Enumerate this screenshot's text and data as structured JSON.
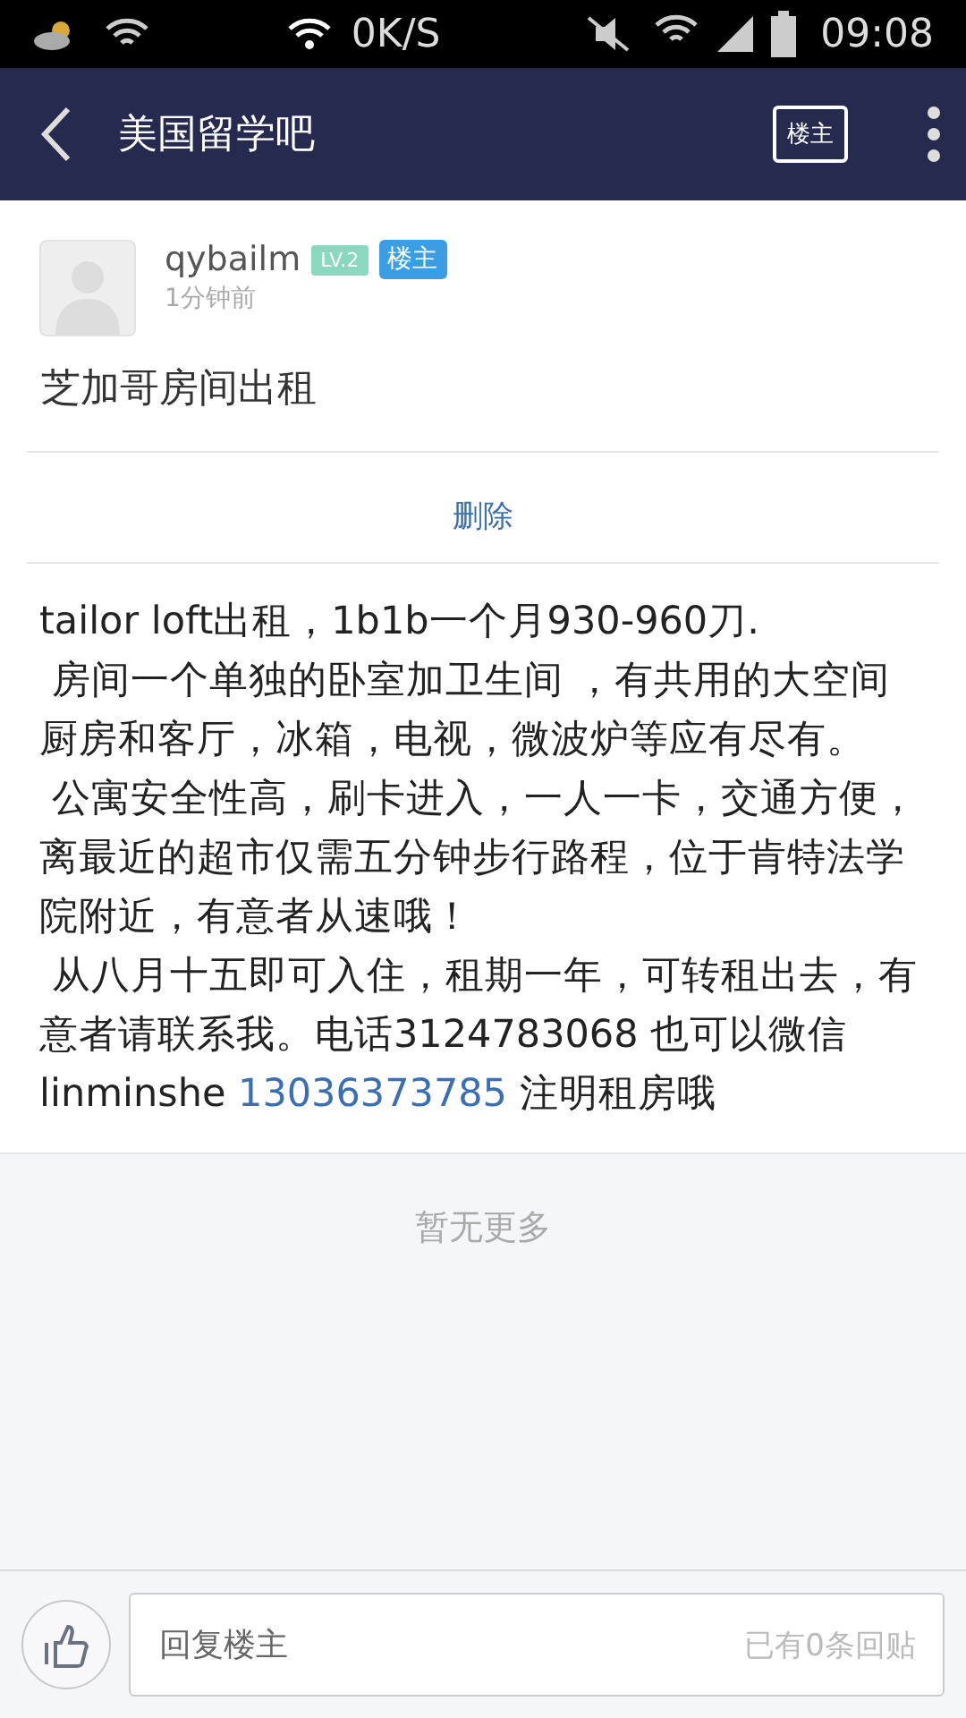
{
  "status_bar": {
    "speed": "0K/S",
    "time": "09:08"
  },
  "nav": {
    "title": "美国留学吧",
    "owner_button": "楼主"
  },
  "post": {
    "author": "qybailm",
    "level": "LV.2",
    "role_badge": "楼主",
    "time": "1分钟前",
    "title": "芝加哥房间出租",
    "delete_link": "删除",
    "paragraphs": [
      [
        {
          "kind": "text",
          "text": "tailor loft出租，1b1b一个月930-960刀."
        }
      ],
      [
        {
          "kind": "text",
          "text": " 房间一个单独的卧室加卫生间 ，有共用的大空间厨房和客厅，冰箱，电视，微波炉等应有尽有。"
        }
      ],
      [
        {
          "kind": "text",
          "text": " 公寓安全性高，刷卡进入，一人一卡，交通方便，离最近的超市仅需五分钟步行路程，位于肯特法学院附近，有意者从速哦！"
        }
      ],
      [
        {
          "kind": "text",
          "text": " 从八月十五即可入住，租期一年，可转租出去，有意者请联系我。电话3124783068 也可以微信linminshe "
        },
        {
          "kind": "link",
          "text": "13036373785"
        },
        {
          "kind": "text",
          "text": " 注明租房哦"
        }
      ]
    ]
  },
  "no_more": "暂无更多",
  "reply_bar": {
    "placeholder": "回复楼主",
    "reply_count": "已有0条回贴"
  }
}
